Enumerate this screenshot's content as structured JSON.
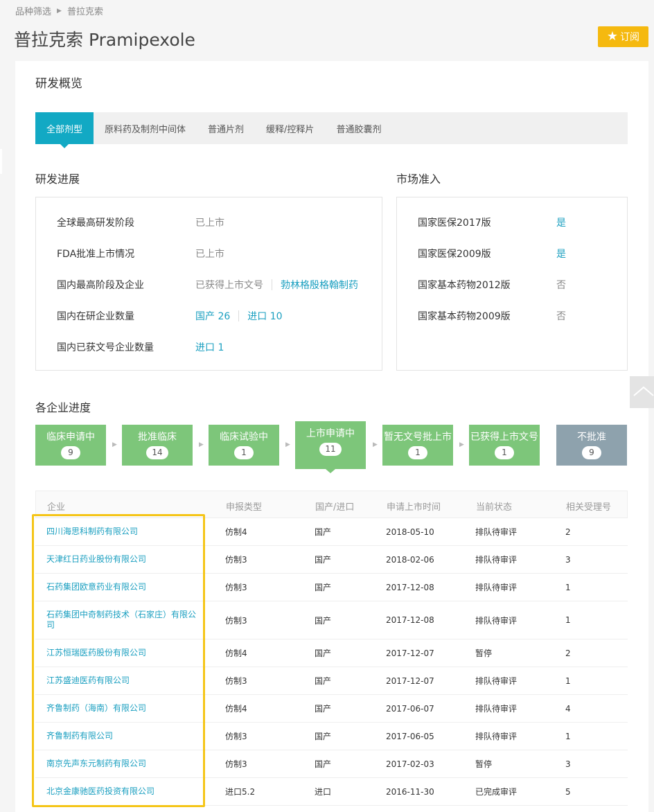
{
  "breadcrumb": {
    "parent": "品种筛选",
    "current": "普拉克索"
  },
  "title": "普拉克索 Pramipexole",
  "subscribe_label": "订阅",
  "overview_title": "研发概览",
  "tabs": [
    "全部剂型",
    "原料药及制剂中间体",
    "普通片剂",
    "缓释/控释片",
    "普通胶囊剂"
  ],
  "progress": {
    "title": "研发进展",
    "rows": [
      {
        "label": "全球最高研发阶段",
        "value": "已上市"
      },
      {
        "label": "FDA批准上市情况",
        "value": "已上市"
      },
      {
        "label": "国内最高阶段及企业",
        "value": "已获得上市文号",
        "link": "勃林格殷格翰制药"
      },
      {
        "label": "国内在研企业数量",
        "link1": "国产 26",
        "link2": "进口 10"
      },
      {
        "label": "国内已获文号企业数量",
        "link1": "进口 1"
      }
    ]
  },
  "market": {
    "title": "市场准入",
    "rows": [
      {
        "label": "国家医保2017版",
        "value": "是"
      },
      {
        "label": "国家医保2009版",
        "value": "是"
      },
      {
        "label": "国家基本药物2012版",
        "value": "否"
      },
      {
        "label": "国家基本药物2009版",
        "value": "否"
      }
    ]
  },
  "company_progress_title": "各企业进度",
  "stages": [
    {
      "label": "临床申请中",
      "count": "9"
    },
    {
      "label": "批准临床",
      "count": "14"
    },
    {
      "label": "临床试验中",
      "count": "1"
    },
    {
      "label": "上市申请中",
      "count": "11"
    },
    {
      "label": "暂无文号批上市",
      "count": "1"
    },
    {
      "label": "已获得上市文号",
      "count": "1"
    },
    {
      "label": "不批准",
      "count": "9"
    }
  ],
  "table": {
    "headers": [
      "企业",
      "申报类型",
      "国产/进口",
      "申请上市时间",
      "当前状态",
      "相关受理号"
    ],
    "rows": [
      [
        "四川海思科制药有限公司",
        "仿制4",
        "国产",
        "2018-05-10",
        "排队待审评",
        "2"
      ],
      [
        "天津红日药业股份有限公司",
        "仿制3",
        "国产",
        "2018-02-06",
        "排队待审评",
        "3"
      ],
      [
        "石药集团欧意药业有限公司",
        "仿制3",
        "国产",
        "2017-12-08",
        "排队待审评",
        "1"
      ],
      [
        "石药集团中奇制药技术（石家庄）有限公司",
        "仿制3",
        "国产",
        "2017-12-08",
        "排队待审评",
        "1"
      ],
      [
        "江苏恒瑞医药股份有限公司",
        "仿制4",
        "国产",
        "2017-12-07",
        "暂停",
        "2"
      ],
      [
        "江苏盛迪医药有限公司",
        "仿制3",
        "国产",
        "2017-12-07",
        "排队待审评",
        "1"
      ],
      [
        "齐鲁制药（海南）有限公司",
        "仿制4",
        "国产",
        "2017-06-07",
        "排队待审评",
        "4"
      ],
      [
        "齐鲁制药有限公司",
        "仿制3",
        "国产",
        "2017-06-05",
        "排队待审评",
        "1"
      ],
      [
        "南京先声东元制药有限公司",
        "仿制3",
        "国产",
        "2017-02-03",
        "暂停",
        "3"
      ],
      [
        "北京金康驰医药投资有限公司",
        "进口5.2",
        "进口",
        "2016-11-30",
        "已完成审评",
        "5"
      ]
    ]
  },
  "colors": {
    "accent": "#12a9c4",
    "stage_green": "#7dc67a",
    "stage_grey": "#8ea2ad",
    "subscribe": "#f5b90f",
    "highlight": "#f5c518"
  }
}
